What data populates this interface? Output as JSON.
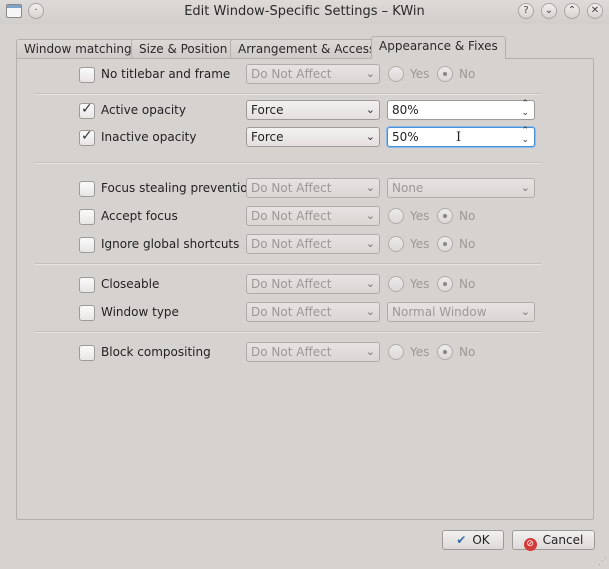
{
  "window": {
    "title": "Edit Window-Specific Settings – KWin",
    "buttons": {
      "help": "?",
      "minimize": "⌄",
      "maximize": "⌃",
      "close": "✕"
    }
  },
  "tabs": [
    {
      "label": "Window matching"
    },
    {
      "label": "Size & Position"
    },
    {
      "label": "Arrangement & Access"
    },
    {
      "label": "Appearance & Fixes"
    }
  ],
  "rows": {
    "no_titlebar": {
      "label": "No titlebar and frame",
      "policy": "Do Not Affect",
      "yes": "Yes",
      "no": "No"
    },
    "active_opacity": {
      "label": "Active opacity",
      "policy": "Force",
      "value": "80%"
    },
    "inactive_opacity": {
      "label": "Inactive opacity",
      "policy": "Force",
      "value": "50%"
    },
    "focus_stealing": {
      "label": "Focus stealing prevention",
      "policy": "Do Not Affect",
      "value": "None"
    },
    "accept_focus": {
      "label": "Accept focus",
      "policy": "Do Not Affect",
      "yes": "Yes",
      "no": "No"
    },
    "ignore_shortcuts": {
      "label": "Ignore global shortcuts",
      "policy": "Do Not Affect",
      "yes": "Yes",
      "no": "No"
    },
    "closeable": {
      "label": "Closeable",
      "policy": "Do Not Affect",
      "yes": "Yes",
      "no": "No"
    },
    "window_type": {
      "label": "Window type",
      "policy": "Do Not Affect",
      "value": "Normal Window"
    },
    "block_compositing": {
      "label": "Block compositing",
      "policy": "Do Not Affect",
      "yes": "Yes",
      "no": "No"
    }
  },
  "footer": {
    "ok": "OK",
    "cancel": "Cancel"
  },
  "colors": {
    "background": "#d6d2d0",
    "focus": "#4a90d9",
    "cancel_icon": "#d43a3a"
  }
}
